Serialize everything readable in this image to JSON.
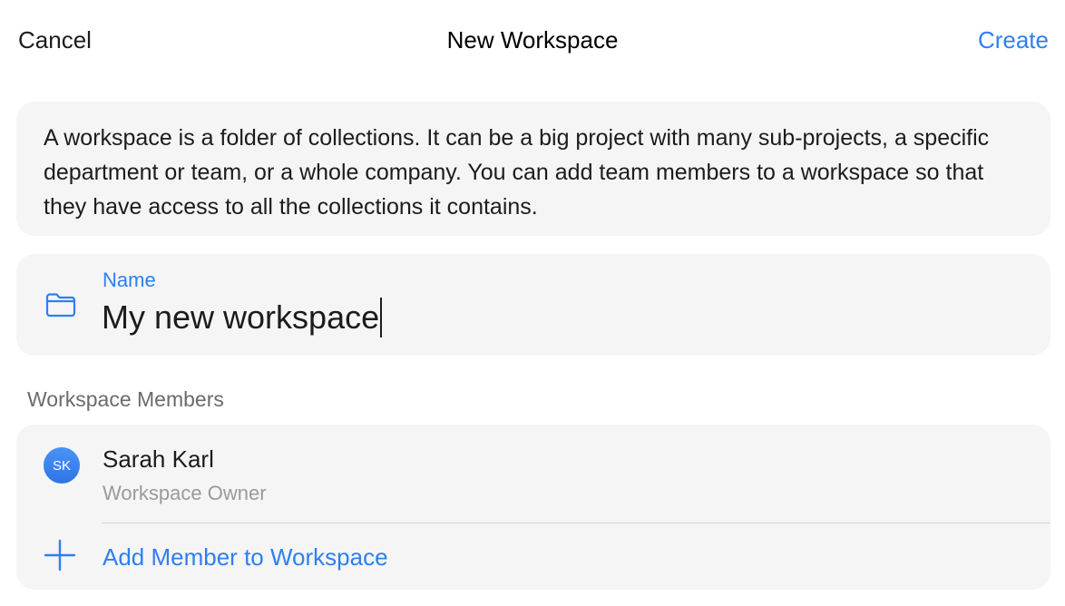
{
  "nav": {
    "cancel_label": "Cancel",
    "title": "New Workspace",
    "create_label": "Create"
  },
  "description": {
    "text": "A workspace is a folder of collections. It can be a big project with many sub-projects, a specific department or team, or a whole company. You can add team members to a workspace so that they have access to all the collections it contains."
  },
  "name_field": {
    "label": "Name",
    "value": "My new workspace",
    "icon": "folder-icon"
  },
  "members": {
    "section_title": "Workspace Members",
    "list": [
      {
        "initials": "SK",
        "name": "Sarah Karl",
        "role": "Workspace Owner"
      }
    ],
    "add_label": "Add Member to Workspace",
    "add_icon": "plus-icon"
  },
  "colors": {
    "accent": "#2f7ff0",
    "card_bg": "#f5f5f5",
    "secondary_text": "#9a9a9e",
    "section_text": "#6b6b6f"
  }
}
